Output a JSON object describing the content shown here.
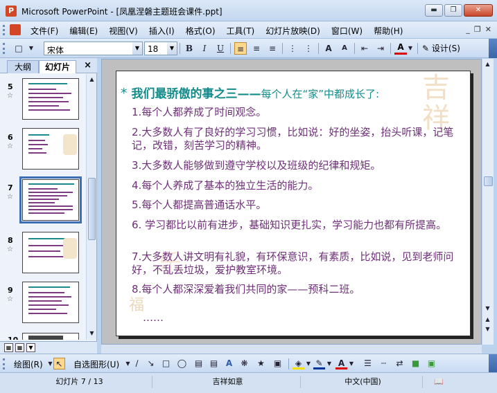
{
  "window": {
    "title": "Microsoft PowerPoint - [凤凰涅磐主题班会课件.ppt]",
    "min_label": "▬",
    "max_label": "❐",
    "close_label": "✕"
  },
  "menu": {
    "items": [
      "文件(F)",
      "编辑(E)",
      "视图(V)",
      "插入(I)",
      "格式(O)",
      "工具(T)",
      "幻灯片放映(D)",
      "窗口(W)",
      "帮助(H)"
    ],
    "doc_controls": [
      "_",
      "❐",
      "✕"
    ]
  },
  "format_toolbar": {
    "font_name": "宋体",
    "font_size": "18",
    "bold": "B",
    "italic": "I",
    "underline": "U",
    "grow_font": "A",
    "shrink_font": "A",
    "font_color": "A",
    "design_label": "设计(S)"
  },
  "left_panel": {
    "tab_outline": "大纲",
    "tab_slides": "幻灯片",
    "close_label": "×",
    "slide_numbers": [
      "5",
      "6",
      "7",
      "8",
      "9",
      "10"
    ],
    "selected_slide": "7"
  },
  "slide": {
    "title_star": "*",
    "title_part1": "我们最骄傲的事之三——",
    "title_part2": "每个人在“家”中都成长了:",
    "items": [
      "1.每个人都养成了时间观念。",
      "2.大多数人有了良好的学习习惯，比如说：好的坐姿，抬头听课，记笔记，改错，刻苦学习的精神。",
      "3.大多数人能够做到遵守学校以及班级的纪律和规矩。",
      "4.每个人养成了基本的独立生活的能力。",
      "5.每个人都提高普通话水平。",
      "6. 学习都比以前有进步，基础知识更扎实，学习能力也都有所提高。",
      "7.大多数人讲文明有礼貌，有环保意识，有素质，比如说，见到老师问好，不乱丢垃圾，爱护教室环境。",
      "8.每个人都深深爱着我们共同的家——预科二班。"
    ],
    "ellipsis": "……"
  },
  "draw_toolbar": {
    "draw_label": "绘图(R)",
    "autoshape_label": "自选图形(U)"
  },
  "status_bar": {
    "slide_position": "幻灯片 7 / 13",
    "template": "吉祥如意",
    "language": "中文(中国)"
  },
  "colors": {
    "title_teal": "#138b8b",
    "body_purple": "#6e2f78",
    "chrome_blue": "#c7daf2"
  }
}
